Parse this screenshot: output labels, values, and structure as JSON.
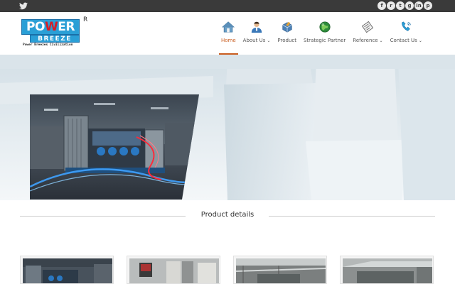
{
  "topbar": {
    "left_icon": "twitter-icon",
    "socials": [
      {
        "icon": "facebook-icon",
        "glyph": "f"
      },
      {
        "icon": "rss-icon",
        "glyph": "r"
      },
      {
        "icon": "twitter-icon",
        "glyph": "t"
      },
      {
        "icon": "google-plus-icon",
        "glyph": "g"
      },
      {
        "icon": "linkedin-icon",
        "glyph": "in"
      },
      {
        "icon": "pinterest-icon",
        "glyph": "p"
      }
    ]
  },
  "logo": {
    "line1_a": "PO",
    "line1_w": "W",
    "line1_b": "ER",
    "line2": "BREEZE",
    "tagline": "Power Breezes Civilization",
    "registered": "R"
  },
  "nav": {
    "items": [
      {
        "label": "Home",
        "icon": "home-icon",
        "active": true,
        "dropdown": false
      },
      {
        "label": "About Us",
        "icon": "person-icon",
        "active": false,
        "dropdown": true
      },
      {
        "label": "Product",
        "icon": "product-icon",
        "active": false,
        "dropdown": false
      },
      {
        "label": "Strategic Partner",
        "icon": "globe-icon",
        "active": false,
        "dropdown": false
      },
      {
        "label": "Reference",
        "icon": "document-icon",
        "active": false,
        "dropdown": true
      },
      {
        "label": "Contact Us",
        "icon": "contact-icon",
        "active": false,
        "dropdown": true
      }
    ],
    "caret": "⌄"
  },
  "section": {
    "title": "Product details"
  },
  "colors": {
    "accent": "#c95d20",
    "topbar": "#3a3a3a",
    "logo_blue": "#2a9fd6",
    "logo_red": "#d81c24"
  }
}
